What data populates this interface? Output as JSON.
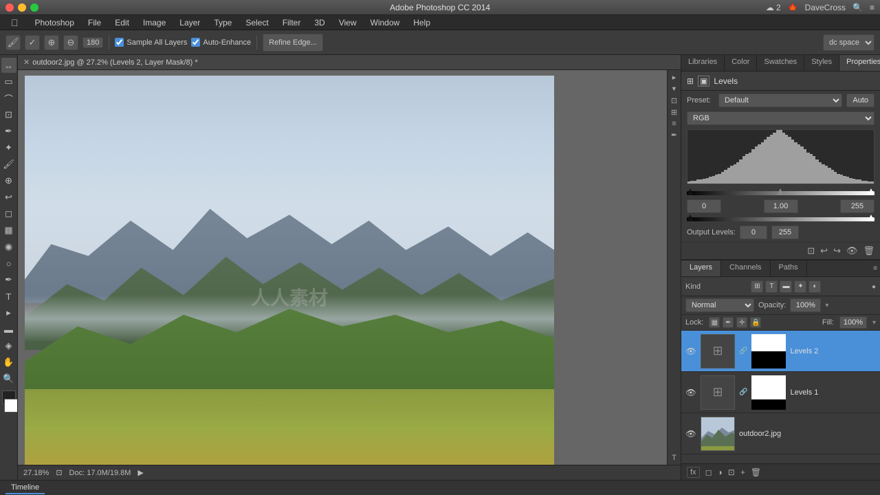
{
  "app": {
    "title": "Adobe Photoshop CC 2014",
    "file_title": "outdoor2.jpg @ 27.2% (Levels 2, Layer Mask/8) *"
  },
  "titlebar": {
    "close_label": "",
    "min_label": "",
    "max_label": "",
    "app_name": "Photoshop",
    "menu_items": [
      "Apple",
      "Photoshop",
      "File",
      "Edit",
      "Image",
      "Layer",
      "Type",
      "Select",
      "Filter",
      "3D",
      "View",
      "Window",
      "Help"
    ],
    "right_user": "DaveCross",
    "right_search": "🔍",
    "right_menu": "≡"
  },
  "toolbar": {
    "brush_size": "180",
    "sample_all_label": "Sample All Layers",
    "enhance_label": "Auto-Enhance",
    "refine_label": "Refine Edge...",
    "sample_checked": true,
    "enhance_checked": true
  },
  "panel_tabs": {
    "items": [
      "Libraries",
      "Color",
      "Swatches",
      "Styles",
      "Properties"
    ],
    "active": "Properties"
  },
  "properties": {
    "title": "Levels",
    "preset_label": "Preset:",
    "preset_value": "Default",
    "channel_value": "RGB",
    "auto_label": "Auto",
    "input_black": "0",
    "input_mid": "1.00",
    "input_white": "255",
    "output_label": "Output Levels:",
    "output_black": "0",
    "output_white": "255"
  },
  "layers_panel": {
    "tabs": [
      "Layers",
      "Channels",
      "Paths"
    ],
    "active_tab": "Layers",
    "filter_label": "Kind",
    "blend_mode": "Normal",
    "opacity_label": "Opacity:",
    "opacity_value": "100%",
    "lock_label": "Lock:",
    "fill_label": "Fill:",
    "fill_value": "100%",
    "layers": [
      {
        "name": "Levels 2",
        "visible": true,
        "has_mask": true,
        "active": true,
        "type": "adjustment"
      },
      {
        "name": "Levels 1",
        "visible": true,
        "has_mask": true,
        "active": false,
        "type": "adjustment"
      },
      {
        "name": "outdoor2.jpg",
        "visible": true,
        "has_mask": false,
        "active": false,
        "type": "image"
      }
    ]
  },
  "status_bar": {
    "zoom": "27.18%",
    "doc_info": "Doc: 17.0M/19.8M"
  },
  "bottom_tab": "Timeline",
  "histogram_data": [
    2,
    3,
    3,
    4,
    4,
    5,
    6,
    7,
    8,
    9,
    10,
    12,
    14,
    16,
    18,
    20,
    22,
    25,
    28,
    30,
    32,
    35,
    38,
    40,
    42,
    45,
    48,
    50,
    52,
    55,
    55,
    52,
    50,
    48,
    45,
    42,
    40,
    38,
    35,
    32,
    30,
    28,
    25,
    22,
    20,
    18,
    16,
    14,
    12,
    10,
    9,
    8,
    7,
    6,
    5,
    4,
    4,
    3,
    3,
    2,
    2
  ]
}
